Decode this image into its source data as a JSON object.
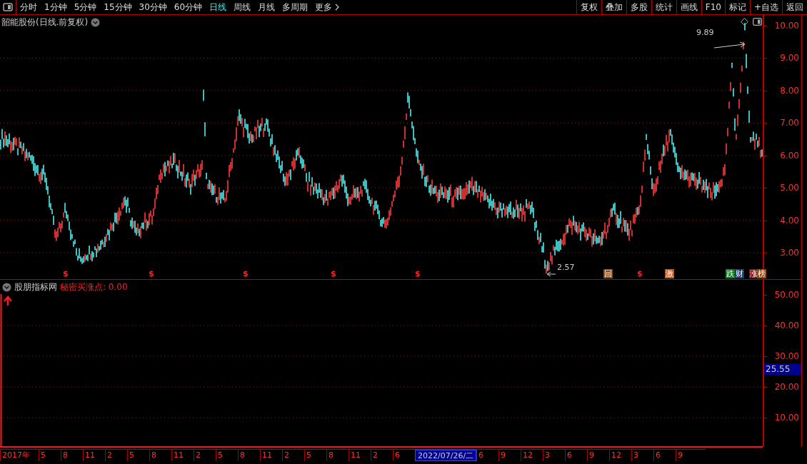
{
  "toolbar": {
    "periods": [
      {
        "label": "分时",
        "selected": false
      },
      {
        "label": "1分钟",
        "selected": false
      },
      {
        "label": "5分钟",
        "selected": false
      },
      {
        "label": "15分钟",
        "selected": false
      },
      {
        "label": "30分钟",
        "selected": false
      },
      {
        "label": "60分钟",
        "selected": false
      },
      {
        "label": "日线",
        "selected": true
      },
      {
        "label": "周线",
        "selected": false
      },
      {
        "label": "月线",
        "selected": false
      },
      {
        "label": "多周期",
        "selected": false
      },
      {
        "label": "更多",
        "selected": false
      }
    ],
    "buttons": [
      "复权",
      "叠加",
      "多股",
      "统计",
      "画线",
      "F10",
      "标记",
      "+自选",
      "返回"
    ]
  },
  "price_panel": {
    "title": "韶能股份(日线.前复权)",
    "high_label": "9.89",
    "low_label": "2.57",
    "y_ticks": [
      "10.00",
      "9.00",
      "8.00",
      "7.00",
      "6.00",
      "5.00",
      "4.00",
      "3.00"
    ],
    "signals": [
      {
        "kind": "dollar",
        "label": "$",
        "color": "#ff2020"
      },
      {
        "kind": "dollar",
        "label": "$",
        "color": "#ff2020"
      },
      {
        "kind": "dollar",
        "label": "$",
        "color": "#ff2020"
      },
      {
        "kind": "dollar",
        "label": "$",
        "color": "#ff2020"
      },
      {
        "kind": "dollar",
        "label": "$",
        "color": "#ff2020"
      },
      {
        "kind": "badge",
        "label": "回",
        "color": "#8b4a14"
      },
      {
        "kind": "dollar",
        "label": "$",
        "color": "#ff2020"
      },
      {
        "kind": "badge",
        "label": "激",
        "color": "#c8561a"
      },
      {
        "kind": "badge",
        "label": "跌",
        "color": "#127a1e"
      },
      {
        "kind": "badge",
        "label": "财",
        "color": "#1a3c78"
      },
      {
        "kind": "badge",
        "label": "涨",
        "color": "#7a1414"
      },
      {
        "kind": "badge",
        "label": "榜",
        "color": "#8b4a14"
      }
    ]
  },
  "indicator_panel": {
    "name": "股朋指标网",
    "formula": "秘密买涨点: 0.00",
    "y_ticks": [
      "50.00",
      "40.00",
      "30.00",
      "20.00",
      "10.00"
    ],
    "current_value": "25.55"
  },
  "date_axis": [
    {
      "label": "2017年",
      "selected": false
    },
    {
      "label": "5",
      "selected": false
    },
    {
      "label": "8",
      "selected": false
    },
    {
      "label": "11",
      "selected": false
    },
    {
      "label": "2",
      "selected": false
    },
    {
      "label": "5",
      "selected": false
    },
    {
      "label": "8",
      "selected": false
    },
    {
      "label": "11",
      "selected": false
    },
    {
      "label": "2",
      "selected": false
    },
    {
      "label": "5",
      "selected": false
    },
    {
      "label": "8",
      "selected": false
    },
    {
      "label": "11",
      "selected": false
    },
    {
      "label": "2",
      "selected": false
    },
    {
      "label": "5",
      "selected": false
    },
    {
      "label": "8",
      "selected": false
    },
    {
      "label": "11",
      "selected": false
    },
    {
      "label": "2",
      "selected": false
    },
    {
      "label": "6",
      "selected": false
    },
    {
      "label": "2022/07/26/二",
      "selected": true
    },
    {
      "label": "6",
      "selected": false
    },
    {
      "label": "9",
      "selected": false
    },
    {
      "label": "12",
      "selected": false
    },
    {
      "label": "3",
      "selected": false
    },
    {
      "label": "6",
      "selected": false
    },
    {
      "label": "9",
      "selected": false
    },
    {
      "label": "12",
      "selected": false
    },
    {
      "label": "3",
      "selected": false
    },
    {
      "label": "6",
      "selected": false
    },
    {
      "label": "9",
      "selected": false
    }
  ]
}
